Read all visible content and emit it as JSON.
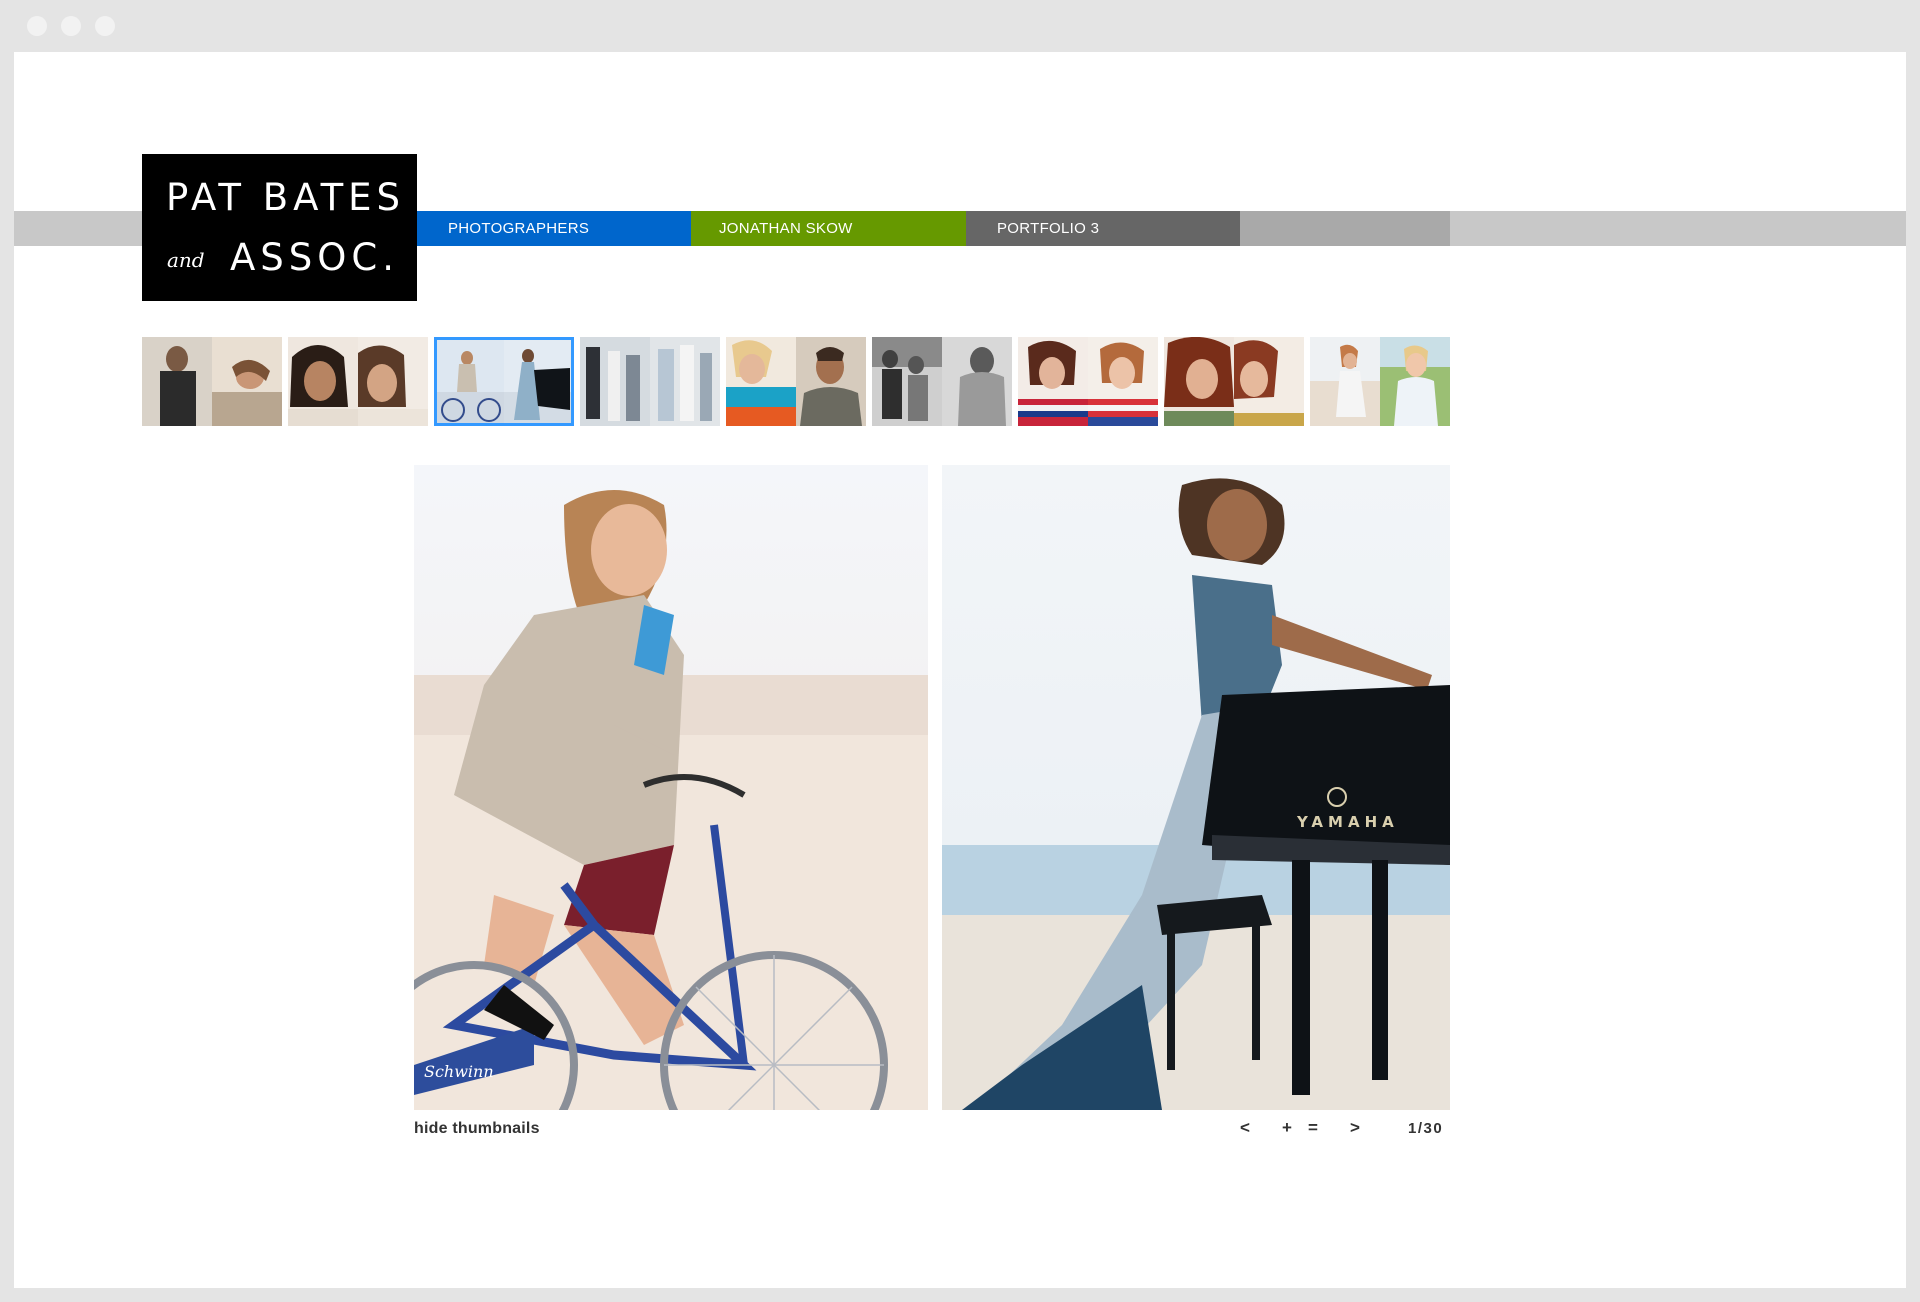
{
  "logo": {
    "line1": "PAT BATES",
    "and": "and",
    "line2": "ASSOC."
  },
  "nav": {
    "photographers": "PHOTOGRAPHERS",
    "photographer_name": "JONATHAN SKOW",
    "portfolio": "PORTFOLIO 3"
  },
  "colors": {
    "tab_photographers": "#0066cc",
    "tab_photographer_name": "#669900",
    "tab_portfolio": "#666666",
    "thumb_selected_border": "#3399ff"
  },
  "thumbnails": [
    {
      "left": "man-in-jacket",
      "right": "woman-lying-on-sand"
    },
    {
      "left": "two-women-smiling",
      "right": "two-women-smiling"
    },
    {
      "left": "woman-on-bicycle",
      "right": "woman-at-piano",
      "selected": true
    },
    {
      "left": "people-in-doorway",
      "right": "people-walking"
    },
    {
      "left": "woman-in-blue",
      "right": "man-in-tshirt"
    },
    {
      "left": "black-and-white-couple",
      "right": "shirtless-man"
    },
    {
      "left": "woman-striped-top",
      "right": "woman-striped-top"
    },
    {
      "left": "woman-redhead-portrait",
      "right": "woman-redhead-portrait"
    },
    {
      "left": "woman-on-beach",
      "right": "woman-on-grass"
    }
  ],
  "viewer": {
    "left_image": "woman-riding-bicycle-on-beach",
    "right_image": "woman-leaning-on-grand-piano-on-beach",
    "piano_brand": "YAMAHA",
    "bike_brand": "Schwinn"
  },
  "controls": {
    "hide_thumbnails": "hide thumbnails",
    "prev": "<",
    "zoom": "+",
    "fit": "=",
    "next": ">",
    "counter": "1/30"
  }
}
